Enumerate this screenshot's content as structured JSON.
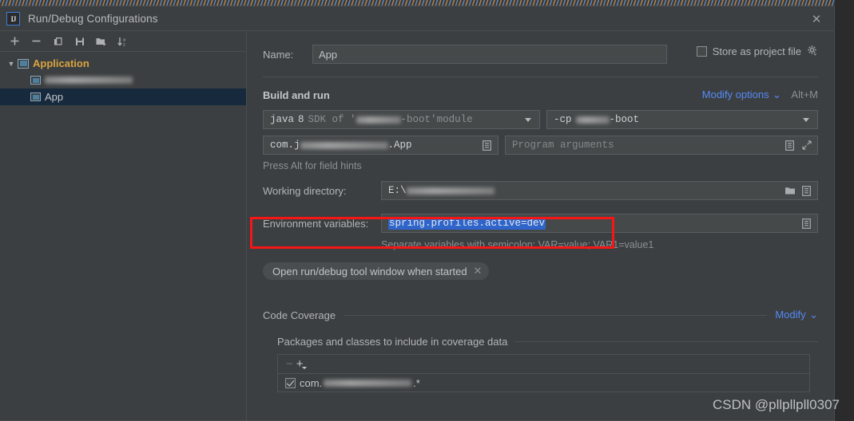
{
  "window": {
    "title": "Run/Debug Configurations",
    "logo_text": "IJ",
    "close_icon": "close-icon"
  },
  "left_toolbar": {
    "buttons": [
      {
        "name": "add-configuration-button",
        "icon": "plus-icon",
        "label": "+"
      },
      {
        "name": "remove-configuration-button",
        "icon": "minus-icon",
        "label": "−"
      },
      {
        "name": "copy-configuration-button",
        "icon": "copy-icon",
        "label": "Copy"
      },
      {
        "name": "save-configuration-button",
        "icon": "save-icon",
        "label": "Save"
      },
      {
        "name": "new-folder-button",
        "icon": "folder-add-icon",
        "label": "New Folder"
      },
      {
        "name": "sort-configurations-button",
        "icon": "sort-az-icon",
        "label": "Sort"
      }
    ]
  },
  "tree": {
    "group_label": "Application",
    "items": [
      {
        "label": "",
        "redacted": true,
        "selected": false
      },
      {
        "label": "App",
        "redacted": false,
        "selected": true
      }
    ]
  },
  "form": {
    "name_label": "Name:",
    "name_value": "App",
    "store_as_project_file_label": "Store as project file",
    "store_as_project_file_checked": false,
    "gear_icon": "gear-icon"
  },
  "build_and_run": {
    "section_title": "Build and run",
    "modify_options_label": "Modify options",
    "modify_options_shortcut": "Alt+M",
    "sdk": {
      "java_word": "java",
      "version": "8",
      "sdk_of_prefix": "SDK of '",
      "module_redacted": true,
      "module_suffix": "-boot'",
      "module_word": " module"
    },
    "classpath": {
      "prefix": "-cp",
      "redacted": true,
      "suffix": "-boot"
    },
    "main_class": {
      "prefix": "com.j",
      "redacted": true,
      "suffix": ".App"
    },
    "program_arguments_placeholder": "Program arguments",
    "hint": "Press Alt for field hints"
  },
  "working_directory": {
    "label": "Working directory:",
    "value_prefix": "E:\\",
    "value_redacted": true,
    "folder_icon": "folder-icon",
    "expand_icon": "expand-macro-icon"
  },
  "environment_variables": {
    "label": "Environment variables:",
    "value": "spring.profiles.active=dev",
    "value_selected": true,
    "browse_icon": "expand-macro-icon",
    "hint": "Separate variables with semicolon: VAR=value; VAR1=value1"
  },
  "chip": {
    "label": "Open run/debug tool window when started",
    "close_icon": "close-small-icon"
  },
  "code_coverage": {
    "section_title": "Code Coverage",
    "modify_label": "Modify",
    "packages_title": "Packages and classes to include in coverage data",
    "toolbar": {
      "remove_label": "−",
      "add_label": "+"
    },
    "items": [
      {
        "checked": true,
        "prefix": "com.",
        "redacted": true,
        "suffix": ".*"
      }
    ]
  },
  "annotation": {
    "color": "#f61616",
    "target": "environment-variables-row"
  },
  "watermark": {
    "text": "CSDN @pllpllpll0307"
  },
  "colors": {
    "dialog_bg": "#3c3f41",
    "field_bg": "#45494a",
    "selection_row": "#16293d",
    "link": "#548af7",
    "group_label": "#d9a441",
    "text_selection": "#2f65ca",
    "annotation_red": "#f61616"
  }
}
